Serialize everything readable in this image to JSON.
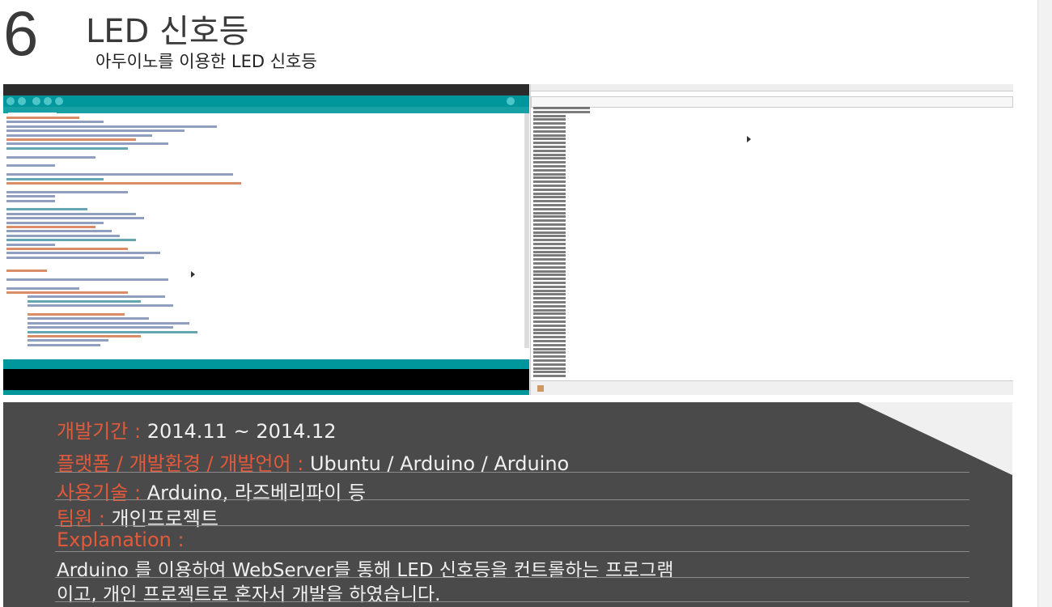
{
  "header": {
    "number": "6",
    "title": "LED 신호등",
    "subtitle": "아두이노를 이용한 LED 신호등"
  },
  "details": {
    "period_label": "개발기간",
    "period_value": "2014.11 ~ 2014.12",
    "platform_label": "플랫폼 / 개발환경 / 개발언어",
    "platform_value": "Ubuntu / Arduino / Arduino",
    "tech_label": "사용기술",
    "tech_value": "Arduino, 라즈베리파이 등",
    "team_label": "팀원",
    "team_value": "개인프로젝트",
    "explanation_label": "Explanation",
    "separator": ":",
    "explanation_line1": "Arduino 를 이용하여 WebServer를 통해 LED 신호등을 컨트롤하는 프로그램",
    "explanation_line2": "이고, 개인 프로젝트로 혼자서 개발을 하였습니다."
  },
  "colors": {
    "panel_bg": "#4a4a4a",
    "label_accent": "#e25a3a",
    "arduino_teal": "#00979c"
  },
  "icons": [
    "mouse-cursor-icon"
  ]
}
